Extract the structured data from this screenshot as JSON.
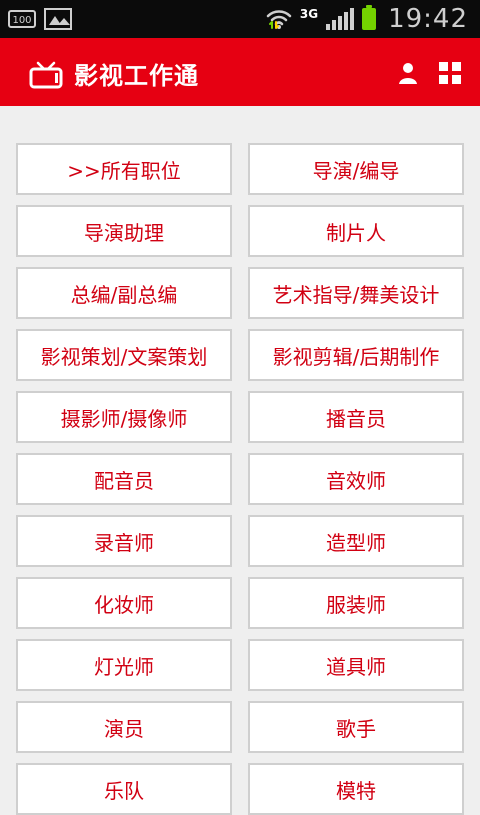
{
  "status_bar": {
    "battery_saver_label": "100",
    "network": "3G",
    "time": "19:42",
    "icons": [
      "image-icon",
      "wifi-icon",
      "signal-icon",
      "battery-icon"
    ]
  },
  "app_bar": {
    "title": "影视工作通",
    "icons": [
      "tv-icon",
      "user-icon",
      "grid-icon"
    ]
  },
  "categories": [
    ">>所有职位",
    "导演/编导",
    "导演助理",
    "制片人",
    "总编/副总编",
    "艺术指导/舞美设计",
    "影视策划/文案策划",
    "影视剪辑/后期制作",
    "摄影师/摄像师",
    "播音员",
    "配音员",
    "音效师",
    "录音师",
    "造型师",
    "化妆师",
    "服装师",
    "灯光师",
    "道具师",
    "演员",
    "歌手",
    "乐队",
    "模特"
  ],
  "colors": {
    "accent_red": "#E60012",
    "button_text_red": "#D10012",
    "background": "#EFEFEF",
    "button_border": "#CFCFCF"
  }
}
